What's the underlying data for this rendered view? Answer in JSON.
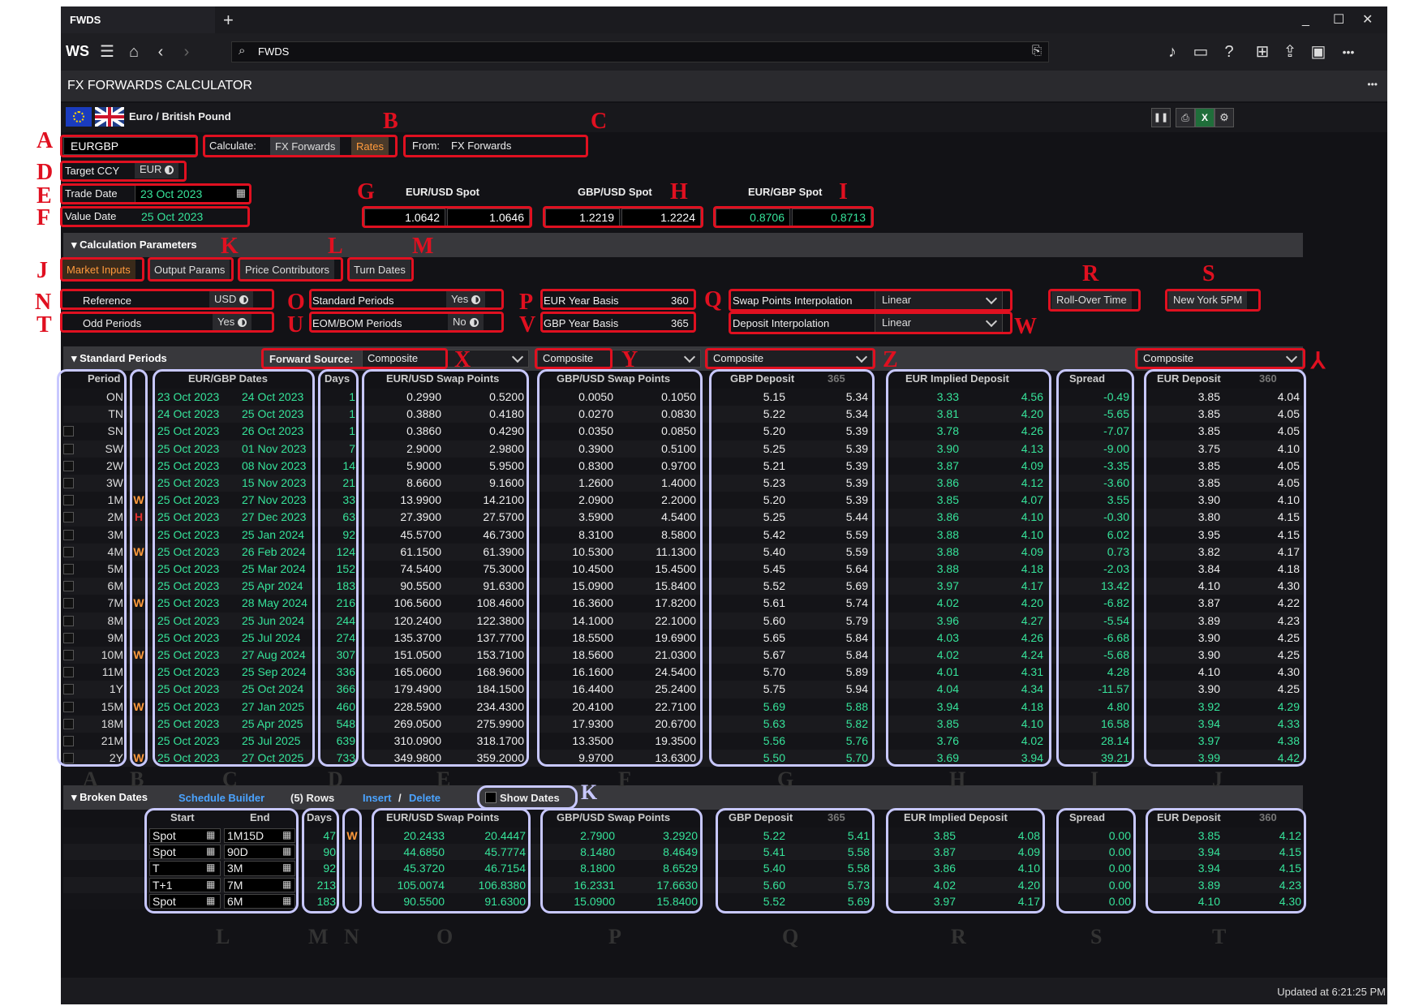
{
  "app": {
    "tab_title": "FWDS",
    "logo": "WS",
    "search_value": "FWDS",
    "page_title": "FX FORWARDS CALCULATOR",
    "pair_name": "Euro / British Pound",
    "more": "•••"
  },
  "inputs": {
    "ric": "EURGBP",
    "calculate_label": "Calculate:",
    "calc_fx": "FX Forwards",
    "calc_rates": "Rates",
    "from_label": "From:",
    "from_value": "FX Forwards",
    "target_ccy_label": "Target CCY",
    "target_ccy": "EUR",
    "trade_date_label": "Trade Date",
    "trade_date": "23 Oct 2023",
    "value_date_label": "Value Date",
    "value_date": "25 Oct 2023"
  },
  "spots": [
    {
      "label": "EUR/USD Spot",
      "bid": "1.0642",
      "ask": "1.0646"
    },
    {
      "label": "GBP/USD Spot",
      "bid": "1.2219",
      "ask": "1.2224"
    },
    {
      "label": "EUR/GBP Spot",
      "bid": "0.8706",
      "ask": "0.8713"
    }
  ],
  "calc_params": {
    "title": "Calculation Parameters",
    "tabs": [
      "Market Inputs",
      "Output Params",
      "Price Contributors",
      "Turn Dates"
    ],
    "reference_label": "Reference",
    "reference": "USD",
    "odd_periods_label": "Odd Periods",
    "odd_periods": "Yes",
    "standard_periods_label": "Standard Periods",
    "standard_periods": "Yes",
    "eom_label": "EOM/BOM Periods",
    "eom": "No",
    "eur_basis_label": "EUR Year Basis",
    "eur_basis": "360",
    "gbp_basis_label": "GBP Year Basis",
    "gbp_basis": "365",
    "swap_interp_label": "Swap Points Interpolation",
    "swap_interp": "Linear",
    "dep_interp_label": "Deposit Interpolation",
    "dep_interp": "Linear",
    "rollover": "Roll-Over Time",
    "ny": "New York 5PM"
  },
  "standard": {
    "title": "Standard Periods",
    "forward_source_label": "Forward Source:",
    "sources": [
      "Composite",
      "Composite",
      "Composite",
      "Composite"
    ],
    "headers": {
      "period": "Period",
      "dates": "EUR/GBP Dates",
      "days": "Days",
      "eurusd": "EUR/USD Swap Points",
      "gbpusd": "GBP/USD Swap Points",
      "gbpdep": "GBP Deposit",
      "gbpdep_basis": "365",
      "eurimpl": "EUR Implied Deposit",
      "spread": "Spread",
      "eurdep": "EUR Deposit",
      "eurdep_basis": "360"
    },
    "rows": [
      {
        "period": "ON",
        "flag": "",
        "start": "23 Oct 2023",
        "end": "24 Oct 2023",
        "days": "1",
        "e1": "0.2990",
        "e2": "0.5200",
        "g1": "0.0050",
        "g2": "0.1050",
        "d1": "5.15",
        "d2": "5.34",
        "i1": "3.33",
        "i2": "4.56",
        "sp": "-0.49",
        "r1": "3.85",
        "r2": "4.04"
      },
      {
        "period": "TN",
        "flag": "",
        "start": "24 Oct 2023",
        "end": "25 Oct 2023",
        "days": "1",
        "e1": "0.3880",
        "e2": "0.4180",
        "g1": "0.0270",
        "g2": "0.0830",
        "d1": "5.22",
        "d2": "5.34",
        "i1": "3.81",
        "i2": "4.20",
        "sp": "-5.65",
        "r1": "3.85",
        "r2": "4.05"
      },
      {
        "period": "SN",
        "flag": "",
        "start": "25 Oct 2023",
        "end": "26 Oct 2023",
        "days": "1",
        "e1": "0.3860",
        "e2": "0.4290",
        "g1": "0.0350",
        "g2": "0.0850",
        "d1": "5.20",
        "d2": "5.39",
        "i1": "3.78",
        "i2": "4.26",
        "sp": "-7.07",
        "r1": "3.85",
        "r2": "4.05"
      },
      {
        "period": "SW",
        "flag": "",
        "start": "25 Oct 2023",
        "end": "01 Nov 2023",
        "days": "7",
        "e1": "2.9000",
        "e2": "2.9800",
        "g1": "0.3900",
        "g2": "0.5100",
        "d1": "5.25",
        "d2": "5.39",
        "i1": "3.90",
        "i2": "4.13",
        "sp": "-9.00",
        "r1": "3.75",
        "r2": "4.10"
      },
      {
        "period": "2W",
        "flag": "",
        "start": "25 Oct 2023",
        "end": "08 Nov 2023",
        "days": "14",
        "e1": "5.9000",
        "e2": "5.9500",
        "g1": "0.8300",
        "g2": "0.9700",
        "d1": "5.21",
        "d2": "5.39",
        "i1": "3.87",
        "i2": "4.09",
        "sp": "-3.35",
        "r1": "3.85",
        "r2": "4.05"
      },
      {
        "period": "3W",
        "flag": "",
        "start": "25 Oct 2023",
        "end": "15 Nov 2023",
        "days": "21",
        "e1": "8.6600",
        "e2": "9.1600",
        "g1": "1.2600",
        "g2": "1.4000",
        "d1": "5.23",
        "d2": "5.39",
        "i1": "3.86",
        "i2": "4.12",
        "sp": "-3.60",
        "r1": "3.85",
        "r2": "4.05"
      },
      {
        "period": "1M",
        "flag": "W",
        "start": "25 Oct 2023",
        "end": "27 Nov 2023",
        "days": "33",
        "e1": "13.9900",
        "e2": "14.2100",
        "g1": "2.0900",
        "g2": "2.2000",
        "d1": "5.20",
        "d2": "5.39",
        "i1": "3.85",
        "i2": "4.07",
        "sp": "3.55",
        "r1": "3.90",
        "r2": "4.10"
      },
      {
        "period": "2M",
        "flag": "H",
        "start": "25 Oct 2023",
        "end": "27 Dec 2023",
        "days": "63",
        "e1": "27.3900",
        "e2": "27.5700",
        "g1": "3.5900",
        "g2": "4.5400",
        "d1": "5.25",
        "d2": "5.44",
        "i1": "3.86",
        "i2": "4.10",
        "sp": "-0.30",
        "r1": "3.80",
        "r2": "4.15"
      },
      {
        "period": "3M",
        "flag": "",
        "start": "25 Oct 2023",
        "end": "25 Jan 2024",
        "days": "92",
        "e1": "45.5700",
        "e2": "46.7300",
        "g1": "8.3100",
        "g2": "8.5800",
        "d1": "5.42",
        "d2": "5.59",
        "i1": "3.88",
        "i2": "4.10",
        "sp": "6.02",
        "r1": "3.95",
        "r2": "4.15"
      },
      {
        "period": "4M",
        "flag": "W",
        "start": "25 Oct 2023",
        "end": "26 Feb 2024",
        "days": "124",
        "e1": "61.1500",
        "e2": "61.3900",
        "g1": "10.5300",
        "g2": "11.1300",
        "d1": "5.40",
        "d2": "5.59",
        "i1": "3.88",
        "i2": "4.09",
        "sp": "0.73",
        "r1": "3.82",
        "r2": "4.17"
      },
      {
        "period": "5M",
        "flag": "",
        "start": "25 Oct 2023",
        "end": "25 Mar 2024",
        "days": "152",
        "e1": "74.5400",
        "e2": "75.3000",
        "g1": "10.4500",
        "g2": "15.4500",
        "d1": "5.45",
        "d2": "5.64",
        "i1": "3.88",
        "i2": "4.18",
        "sp": "-2.03",
        "r1": "3.84",
        "r2": "4.18"
      },
      {
        "period": "6M",
        "flag": "",
        "start": "25 Oct 2023",
        "end": "25 Apr 2024",
        "days": "183",
        "e1": "90.5500",
        "e2": "91.6300",
        "g1": "15.0900",
        "g2": "15.8400",
        "d1": "5.52",
        "d2": "5.69",
        "i1": "3.97",
        "i2": "4.17",
        "sp": "13.42",
        "r1": "4.10",
        "r2": "4.30"
      },
      {
        "period": "7M",
        "flag": "W",
        "start": "25 Oct 2023",
        "end": "28 May 2024",
        "days": "216",
        "e1": "106.5600",
        "e2": "108.4600",
        "g1": "16.3600",
        "g2": "17.8200",
        "d1": "5.61",
        "d2": "5.74",
        "i1": "4.02",
        "i2": "4.20",
        "sp": "-6.82",
        "r1": "3.87",
        "r2": "4.22"
      },
      {
        "period": "8M",
        "flag": "",
        "start": "25 Oct 2023",
        "end": "25 Jun 2024",
        "days": "244",
        "e1": "120.2400",
        "e2": "122.3800",
        "g1": "14.1000",
        "g2": "22.1000",
        "d1": "5.60",
        "d2": "5.79",
        "i1": "3.96",
        "i2": "4.27",
        "sp": "-5.54",
        "r1": "3.89",
        "r2": "4.23"
      },
      {
        "period": "9M",
        "flag": "",
        "start": "25 Oct 2023",
        "end": "25 Jul 2024",
        "days": "274",
        "e1": "135.3700",
        "e2": "137.7700",
        "g1": "18.5500",
        "g2": "19.6900",
        "d1": "5.65",
        "d2": "5.84",
        "i1": "4.03",
        "i2": "4.26",
        "sp": "-6.68",
        "r1": "3.90",
        "r2": "4.25"
      },
      {
        "period": "10M",
        "flag": "W",
        "start": "25 Oct 2023",
        "end": "27 Aug 2024",
        "days": "307",
        "e1": "151.0500",
        "e2": "153.7100",
        "g1": "18.5600",
        "g2": "21.0300",
        "d1": "5.67",
        "d2": "5.84",
        "i1": "4.02",
        "i2": "4.24",
        "sp": "-5.68",
        "r1": "3.90",
        "r2": "4.25"
      },
      {
        "period": "11M",
        "flag": "",
        "start": "25 Oct 2023",
        "end": "25 Sep 2024",
        "days": "336",
        "e1": "165.0600",
        "e2": "168.9600",
        "g1": "16.1600",
        "g2": "24.5400",
        "d1": "5.70",
        "d2": "5.89",
        "i1": "4.01",
        "i2": "4.31",
        "sp": "4.28",
        "r1": "4.10",
        "r2": "4.30"
      },
      {
        "period": "1Y",
        "flag": "",
        "start": "25 Oct 2023",
        "end": "25 Oct 2024",
        "days": "366",
        "e1": "179.4900",
        "e2": "184.1500",
        "g1": "16.4400",
        "g2": "25.2400",
        "d1": "5.75",
        "d2": "5.94",
        "i1": "4.04",
        "i2": "4.34",
        "sp": "-11.57",
        "r1": "3.90",
        "r2": "4.25"
      },
      {
        "period": "15M",
        "flag": "W",
        "start": "25 Oct 2023",
        "end": "27 Jan 2025",
        "days": "460",
        "e1": "228.5900",
        "e2": "234.4300",
        "g1": "20.4100",
        "g2": "22.7100",
        "d1": "5.69",
        "d2": "5.88",
        "i1": "3.94",
        "i2": "4.18",
        "sp": "4.80",
        "r1": "3.92",
        "r2": "4.29"
      },
      {
        "period": "18M",
        "flag": "",
        "start": "25 Oct 2023",
        "end": "25 Apr 2025",
        "days": "548",
        "e1": "269.0500",
        "e2": "275.9900",
        "g1": "17.9300",
        "g2": "20.6700",
        "d1": "5.63",
        "d2": "5.82",
        "i1": "3.85",
        "i2": "4.10",
        "sp": "16.58",
        "r1": "3.94",
        "r2": "4.33"
      },
      {
        "period": "21M",
        "flag": "",
        "start": "25 Oct 2023",
        "end": "25 Jul 2025",
        "days": "639",
        "e1": "310.0900",
        "e2": "318.1700",
        "g1": "13.3500",
        "g2": "19.3500",
        "d1": "5.56",
        "d2": "5.76",
        "i1": "3.76",
        "i2": "4.02",
        "sp": "28.14",
        "r1": "3.97",
        "r2": "4.38"
      },
      {
        "period": "2Y",
        "flag": "W",
        "start": "25 Oct 2023",
        "end": "27 Oct 2025",
        "days": "733",
        "e1": "349.9800",
        "e2": "359.2000",
        "g1": "9.9700",
        "g2": "13.6300",
        "d1": "5.50",
        "d2": "5.70",
        "i1": "3.69",
        "i2": "3.94",
        "sp": "39.21",
        "r1": "3.99",
        "r2": "4.42"
      }
    ]
  },
  "broken": {
    "title": "Broken Dates",
    "schedule_builder": "Schedule Builder",
    "rows_count": "(5) Rows",
    "insert": "Insert",
    "sep": "/",
    "delete": "Delete",
    "show_dates": "Show Dates",
    "headers": {
      "start": "Start",
      "end": "End",
      "days": "Days",
      "eurusd": "EUR/USD Swap Points",
      "gbpusd": "GBP/USD Swap Points",
      "gbpdep": "GBP Deposit",
      "gbpdep_basis": "365",
      "eurimpl": "EUR Implied Deposit",
      "spread": "Spread",
      "eurdep": "EUR Deposit",
      "eurdep_basis": "360"
    },
    "rows": [
      {
        "start": "Spot",
        "end": "1M15D",
        "days": "47",
        "flag": "W",
        "e1": "20.2433",
        "e2": "20.4447",
        "g1": "2.7900",
        "g2": "3.2920",
        "d1": "5.22",
        "d2": "5.41",
        "i1": "3.85",
        "i2": "4.08",
        "sp": "0.00",
        "r1": "3.85",
        "r2": "4.12"
      },
      {
        "start": "Spot",
        "end": "90D",
        "days": "90",
        "flag": "",
        "e1": "44.6850",
        "e2": "45.7774",
        "g1": "8.1480",
        "g2": "8.4649",
        "d1": "5.41",
        "d2": "5.58",
        "i1": "3.87",
        "i2": "4.09",
        "sp": "0.00",
        "r1": "3.94",
        "r2": "4.15"
      },
      {
        "start": "T",
        "end": "3M",
        "days": "92",
        "flag": "",
        "e1": "45.3720",
        "e2": "46.7154",
        "g1": "8.1800",
        "g2": "8.6529",
        "d1": "5.40",
        "d2": "5.58",
        "i1": "3.86",
        "i2": "4.10",
        "sp": "0.00",
        "r1": "3.94",
        "r2": "4.15"
      },
      {
        "start": "T+1",
        "end": "7M",
        "days": "213",
        "flag": "",
        "e1": "105.0074",
        "e2": "106.8380",
        "g1": "16.2331",
        "g2": "17.6630",
        "d1": "5.60",
        "d2": "5.73",
        "i1": "4.02",
        "i2": "4.20",
        "sp": "0.00",
        "r1": "3.89",
        "r2": "4.23"
      },
      {
        "start": "Spot",
        "end": "6M",
        "days": "183",
        "flag": "",
        "e1": "90.5500",
        "e2": "91.6300",
        "g1": "15.0900",
        "g2": "15.8400",
        "d1": "5.52",
        "d2": "5.69",
        "i1": "3.97",
        "i2": "4.17",
        "sp": "0.00",
        "r1": "4.10",
        "r2": "4.30"
      }
    ]
  },
  "status": {
    "updated": "Updated at  6:21:25 PM"
  },
  "annotations": {
    "red": [
      "A",
      "B",
      "C",
      "D",
      "E",
      "F",
      "G",
      "H",
      "I",
      "J",
      "K",
      "L",
      "M",
      "N",
      "O",
      "P",
      "Q",
      "R",
      "S",
      "T",
      "U",
      "V",
      "W",
      "X",
      "Y",
      "Z",
      "⅄"
    ],
    "columns_std": [
      "A",
      "B",
      "C",
      "D",
      "E",
      "F",
      "G",
      "H",
      "I",
      "J"
    ],
    "columns_broken": [
      "L",
      "M",
      "N",
      "O",
      "P",
      "Q",
      "R",
      "S",
      "T"
    ],
    "show_dates_letter": "K"
  },
  "icons": [
    "home-icon",
    "back-icon",
    "forward-icon",
    "search-icon",
    "bookmark-icon",
    "bell-icon",
    "chat-icon",
    "help-icon",
    "new-window-icon",
    "share-icon",
    "save-icon",
    "more-icon",
    "pause-icon",
    "print-icon",
    "excel-icon",
    "gear-icon",
    "calendar-icon",
    "eu-flag-icon",
    "uk-flag-icon"
  ],
  "colors": {
    "accent_green": "#36e39a",
    "accent_orange": "#ff9a3c",
    "annotation_red": "#e01020",
    "column_box": "#c8c8ff",
    "bg": "#121216"
  }
}
